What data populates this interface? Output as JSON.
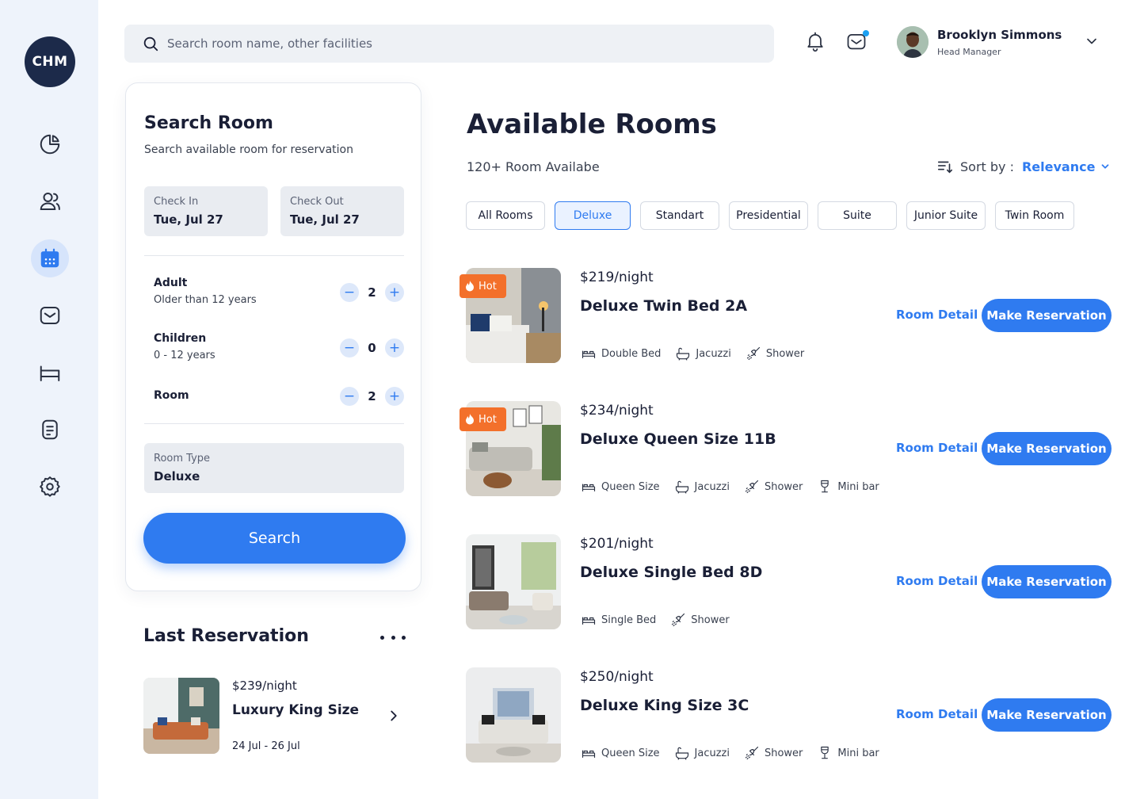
{
  "sidebar": {
    "logo": "CHM",
    "items": [
      {
        "icon": "chart-pie-icon",
        "active": false
      },
      {
        "icon": "users-icon",
        "active": false
      },
      {
        "icon": "calendar-icon",
        "active": true
      },
      {
        "icon": "mail-icon",
        "active": false
      },
      {
        "icon": "bed-icon",
        "active": false
      },
      {
        "icon": "document-icon",
        "active": false
      },
      {
        "icon": "gear-icon",
        "active": false
      }
    ]
  },
  "header": {
    "search_placeholder": "Search room name, other facilities",
    "user_name": "Brooklyn Simmons",
    "user_role": "Head Manager"
  },
  "search_room": {
    "title": "Search Room",
    "subtitle": "Search available room for reservation",
    "check_in_label": "Check In",
    "check_in_value": "Tue, Jul 27",
    "check_out_label": "Check Out",
    "check_out_value": "Tue, Jul 27",
    "adult_label": "Adult",
    "adult_sub": "Older than 12 years",
    "adult_value": "2",
    "children_label": "Children",
    "children_sub": "0 - 12 years",
    "children_value": "0",
    "room_label": "Room",
    "room_value": "2",
    "room_type_label": "Room Type",
    "room_type_value": "Deluxe",
    "search_button": "Search"
  },
  "last_reservation": {
    "title": "Last Reservation",
    "price": "$239/night",
    "name": "Luxury King Size",
    "dates": "24 Jul - 26 Jul"
  },
  "available": {
    "title": "Available Rooms",
    "count": "120+ Room Availabe",
    "sort_label": "Sort by :",
    "sort_value": "Relevance",
    "tabs": [
      "All Rooms",
      "Deluxe",
      "Standart",
      "Presidential",
      "Suite",
      "Junior Suite",
      "Twin Room"
    ],
    "active_tab": "Deluxe",
    "hot_label": "Hot",
    "room_detail_label": "Room Detail",
    "make_reservation_label": "Make Reservation",
    "rooms": [
      {
        "price": "$219/night",
        "name": "Deluxe Twin Bed 2A",
        "hot": true,
        "facilities": [
          "Double Bed",
          "Jacuzzi",
          "Shower"
        ]
      },
      {
        "price": "$234/night",
        "name": "Deluxe Queen Size 11B",
        "hot": true,
        "facilities": [
          "Queen Size",
          "Jacuzzi",
          "Shower",
          "Mini bar"
        ]
      },
      {
        "price": "$201/night",
        "name": "Deluxe Single Bed 8D",
        "hot": false,
        "facilities": [
          "Single Bed",
          "Shower"
        ]
      },
      {
        "price": "$250/night",
        "name": "Deluxe King Size 3C",
        "hot": false,
        "facilities": [
          "Queen Size",
          "Jacuzzi",
          "Shower",
          "Mini bar"
        ]
      }
    ]
  },
  "colors": {
    "accent": "#2f7bf0",
    "hot": "#f3702b",
    "navy": "#1c2a4a"
  }
}
